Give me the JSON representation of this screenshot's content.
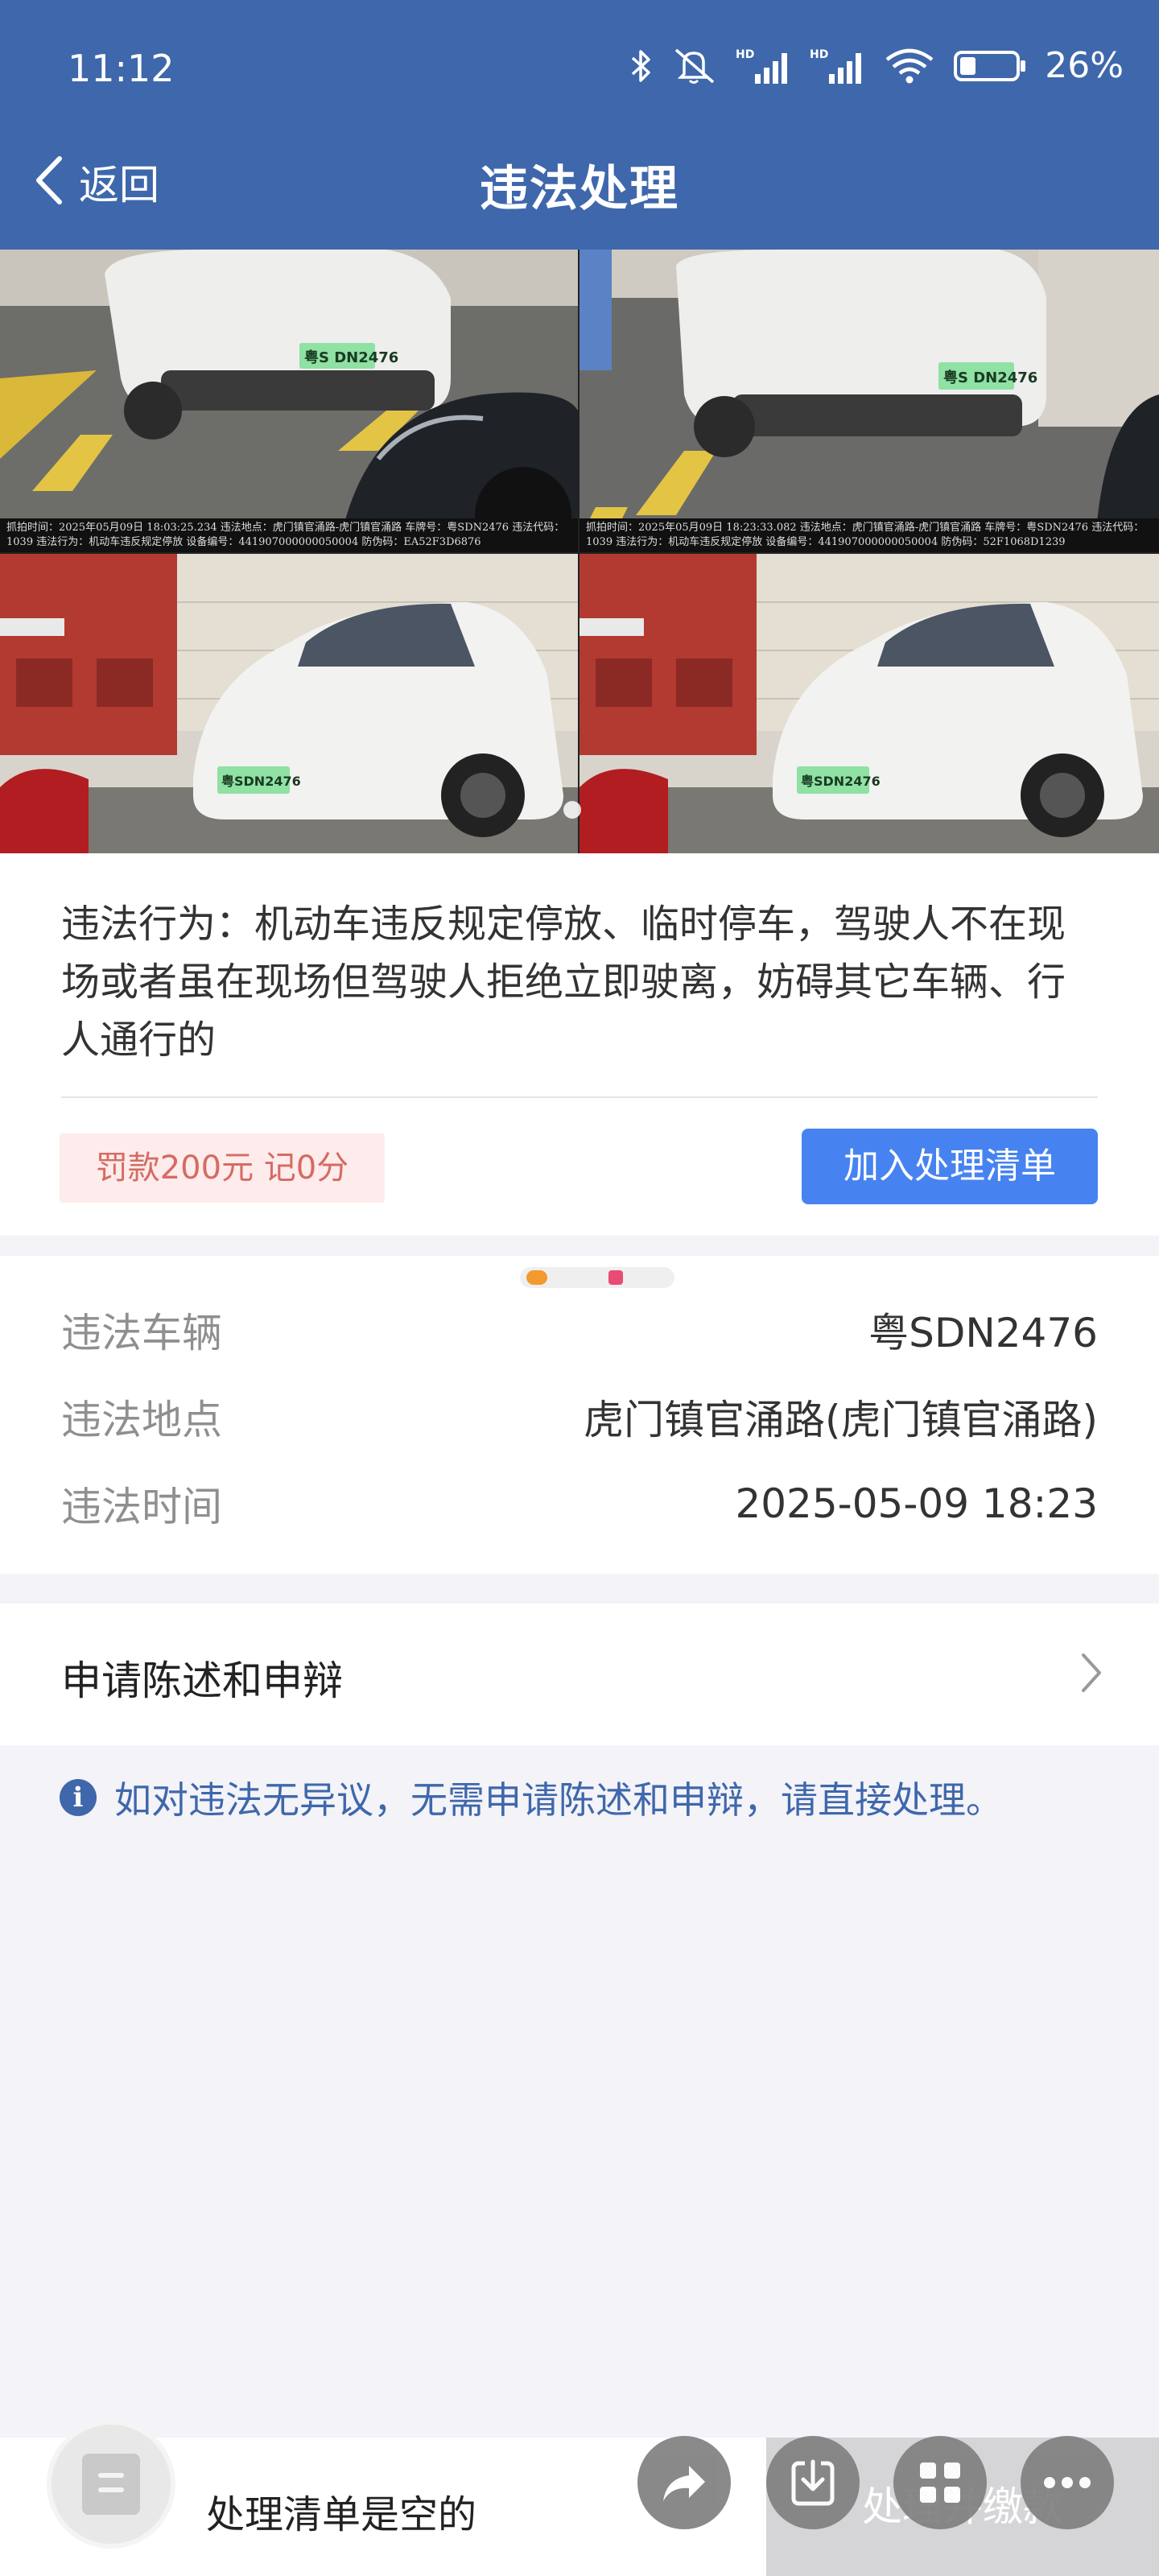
{
  "status_bar": {
    "time": "11:12",
    "battery": "26%",
    "hd1": "HD",
    "hd2": "HD"
  },
  "nav": {
    "back_label": "返回",
    "title": "违法处理"
  },
  "photos": {
    "captions": [
      "抓拍时间：2025年05月09日 18:03:25.234  违法地点：虎门镇官涌路-虎门镇官涌路  车牌号：粤SDN2476  违法代码：1039  违法行为：机动车违反规定停放  设备编号：441907000000050004  防伪码：EA52F3D6876",
      "抓拍时间：2025年05月09日 18:23:33.082  违法地点：虎门镇官涌路-虎门镇官涌路  车牌号：粤SDN2476  违法代码：1039  违法行为：机动车违反规定停放  设备编号：441907000000050004  防伪码：52F1068D1239"
    ],
    "plates": [
      "粤S DN2476",
      "粤S DN2476",
      "粤SDN2476",
      "粤SDN2476"
    ]
  },
  "violation": {
    "description": "违法行为：机动车违反规定停放、临时停车，驾驶人不在现场或者虽在现场但驾驶人拒绝立即驶离，妨碍其它车辆、行人通行的",
    "fine": "罚款200元 记0分",
    "add_button": "加入处理清单"
  },
  "details": [
    {
      "label": "违法车辆",
      "value": "粤SDN2476"
    },
    {
      "label": "违法地点",
      "value": "虎门镇官涌路(虎门镇官涌路)"
    },
    {
      "label": "违法时间",
      "value": "2025-05-09 18:23"
    }
  ],
  "appeal": {
    "label": "申请陈述和申辩"
  },
  "notice": {
    "text": "如对违法无异议，无需申请陈述和申辩，请直接处理。"
  },
  "bottom": {
    "cart_text": "处理清单是空的",
    "pay_button": "处理并缴款"
  },
  "colors": {
    "header": "#3f67ab",
    "accent": "#4783f0",
    "fine_text": "#d56b63",
    "fine_bg": "#fdeceb"
  },
  "icons": [
    "back-chevron-icon",
    "bluetooth-icon",
    "mute-icon",
    "signal-icon",
    "wifi-icon",
    "battery-icon",
    "chevron-right-icon",
    "info-icon",
    "cart-icon",
    "share-icon",
    "download-icon",
    "grid-icon",
    "more-icon"
  ]
}
